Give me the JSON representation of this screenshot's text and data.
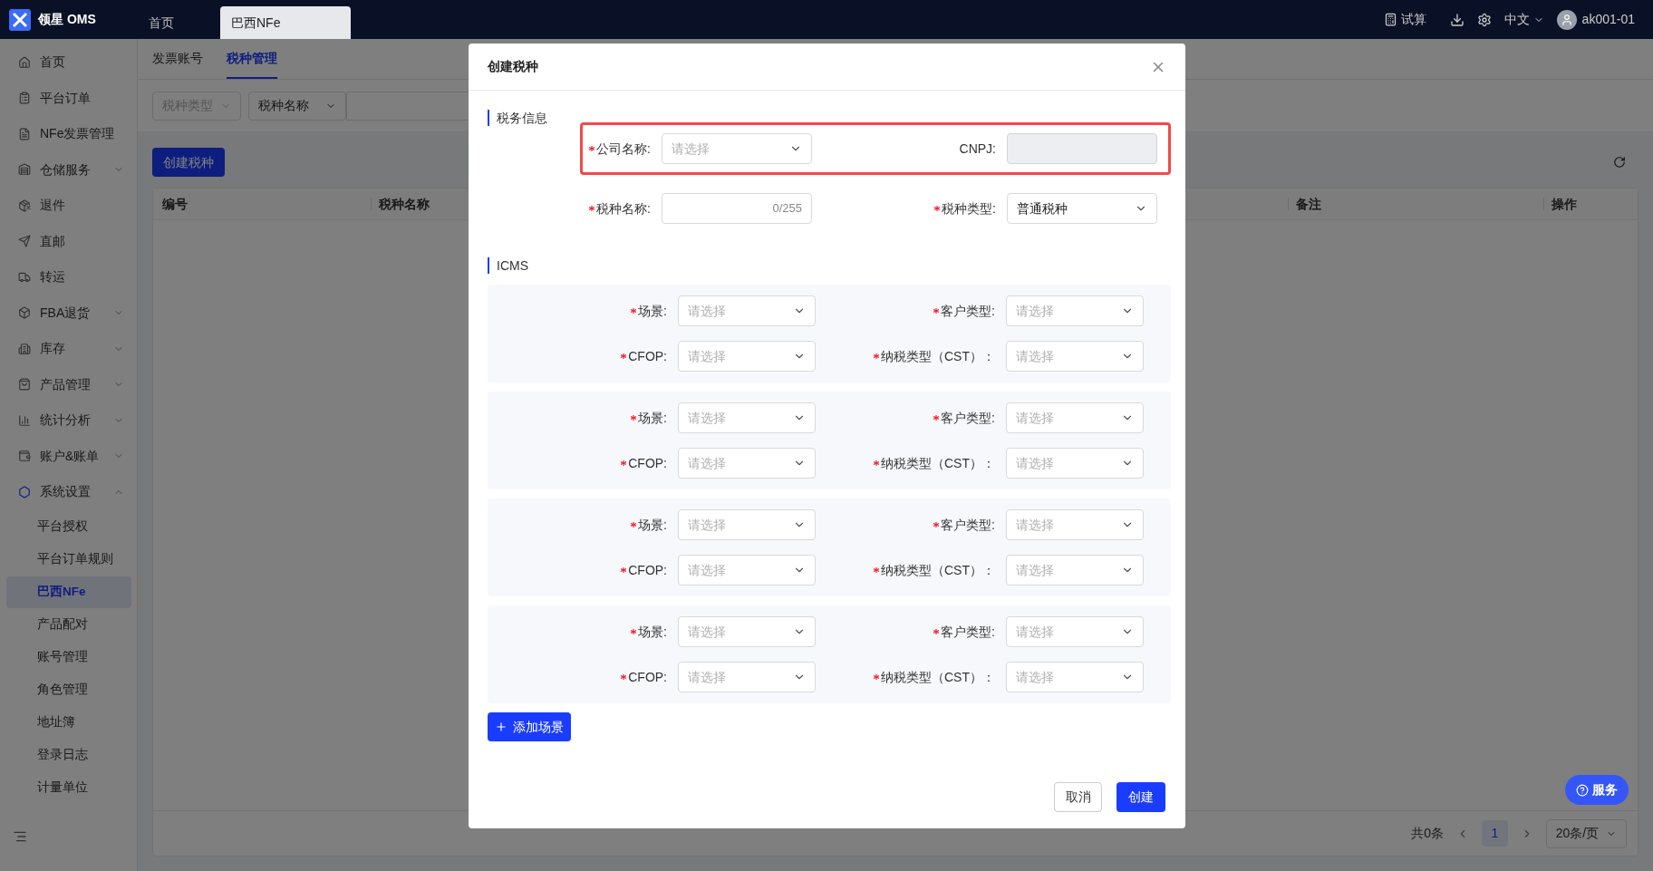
{
  "topbar": {
    "logo_text": "领星 OMS",
    "tabs": [
      {
        "label": "首页",
        "selected": false
      },
      {
        "label": "巴西NFe",
        "selected": true
      }
    ],
    "trial": "试算",
    "language": "中文",
    "username": "ak001-01"
  },
  "sidebar": {
    "items": [
      {
        "label": "首页"
      },
      {
        "label": "平台订单"
      },
      {
        "label": "NFe发票管理"
      },
      {
        "label": "仓储服务",
        "expanded": false
      },
      {
        "label": "退件"
      },
      {
        "label": "直邮"
      },
      {
        "label": "转运"
      },
      {
        "label": "FBA退货",
        "expanded": false
      },
      {
        "label": "库存",
        "expanded": false
      },
      {
        "label": "产品管理",
        "expanded": false
      },
      {
        "label": "统计分析",
        "expanded": false
      },
      {
        "label": "账户&账单",
        "expanded": false
      },
      {
        "label": "系统设置",
        "expanded": true,
        "children": [
          {
            "label": "平台授权",
            "selected": false
          },
          {
            "label": "平台订单规则",
            "selected": false
          },
          {
            "label": "巴西NFe",
            "selected": true
          },
          {
            "label": "产品配对",
            "selected": false
          },
          {
            "label": "账号管理",
            "selected": false
          },
          {
            "label": "角色管理",
            "selected": false
          },
          {
            "label": "地址簿",
            "selected": false
          },
          {
            "label": "登录日志",
            "selected": false
          },
          {
            "label": "计量单位",
            "selected": false
          }
        ]
      }
    ]
  },
  "page": {
    "tabs": [
      {
        "label": "发票账号",
        "selected": false
      },
      {
        "label": "税种管理",
        "selected": true
      }
    ],
    "filters": [
      {
        "placeholder": "税种类型"
      },
      {
        "value": "税种名称"
      }
    ],
    "create_button": "创建税种",
    "table": {
      "columns": [
        "编号",
        "税种名称",
        "备注",
        "操作"
      ]
    },
    "pagination": {
      "total": "共0条",
      "pages": [
        {
          "label": "1",
          "selected": true
        }
      ],
      "page_size": "20条/页"
    }
  },
  "dialog": {
    "title": "创建税种",
    "section": {
      "title": "税务信息",
      "rows": [
        {
          "highlighted": true,
          "fields": [
            {
              "label": "公司名称:",
              "required": true,
              "kind": "select",
              "placeholder": "请选择"
            },
            {
              "label": "CNPJ:",
              "required": false,
              "kind": "input",
              "disabled": true
            }
          ]
        },
        {
          "highlighted": false,
          "fields": [
            {
              "label": "税种名称:",
              "required": true,
              "kind": "counter",
              "counter": "0/255"
            },
            {
              "label": "税种类型:",
              "required": true,
              "kind": "select",
              "value": "普通税种"
            }
          ]
        }
      ]
    },
    "icms": {
      "title": "ICMS",
      "groups": [
        {
          "fields": [
            {
              "label": "场景:",
              "required": true,
              "placeholder": "请选择"
            },
            {
              "label": "客户类型:",
              "required": true,
              "placeholder": "请选择"
            },
            {
              "label": "CFOP:",
              "required": true,
              "placeholder": "请选择"
            },
            {
              "label": "纳税类型（CST）：",
              "required": true,
              "placeholder": "请选择"
            }
          ]
        },
        {
          "fields": [
            {
              "label": "场景:",
              "required": true,
              "placeholder": "请选择"
            },
            {
              "label": "客户类型:",
              "required": true,
              "placeholder": "请选择"
            },
            {
              "label": "CFOP:",
              "required": true,
              "placeholder": "请选择"
            },
            {
              "label": "纳税类型（CST）：",
              "required": true,
              "placeholder": "请选择"
            }
          ]
        },
        {
          "fields": [
            {
              "label": "场景:",
              "required": true,
              "placeholder": "请选择"
            },
            {
              "label": "客户类型:",
              "required": true,
              "placeholder": "请选择"
            },
            {
              "label": "CFOP:",
              "required": true,
              "placeholder": "请选择"
            },
            {
              "label": "纳税类型（CST）：",
              "required": true,
              "placeholder": "请选择"
            }
          ]
        },
        {
          "fields": [
            {
              "label": "场景:",
              "required": true,
              "placeholder": "请选择"
            },
            {
              "label": "客户类型:",
              "required": true,
              "placeholder": "请选择"
            },
            {
              "label": "CFOP:",
              "required": true,
              "placeholder": "请选择"
            },
            {
              "label": "纳税类型（CST）：",
              "required": true,
              "placeholder": "请选择"
            }
          ]
        }
      ]
    },
    "add_button": "添加场景",
    "cancel_button": "取消",
    "confirm_button": "创建"
  },
  "service_button": "服务"
}
